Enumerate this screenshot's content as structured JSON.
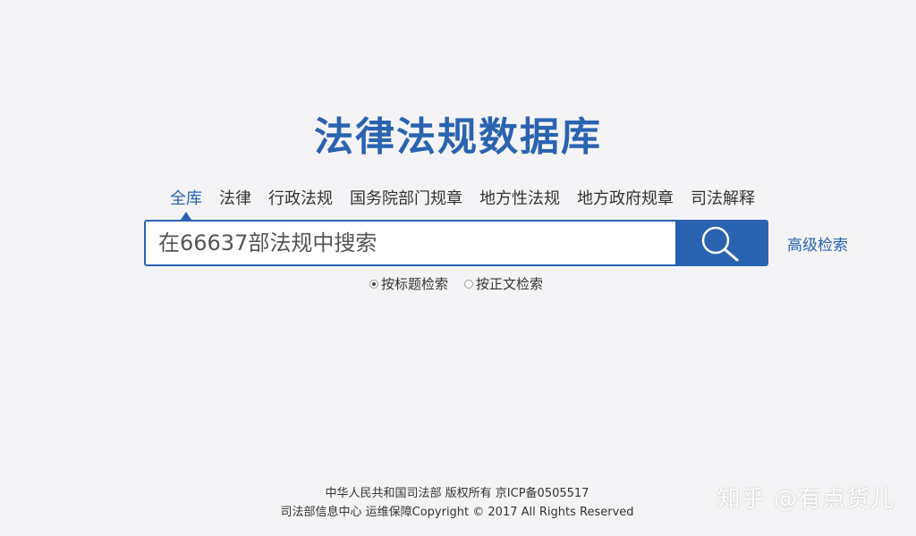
{
  "site_title": "法律法规数据库",
  "tabs": [
    {
      "label": "全库",
      "active": true
    },
    {
      "label": "法律",
      "active": false
    },
    {
      "label": "行政法规",
      "active": false
    },
    {
      "label": "国务院部门规章",
      "active": false
    },
    {
      "label": "地方性法规",
      "active": false
    },
    {
      "label": "地方政府规章",
      "active": false
    },
    {
      "label": "司法解释",
      "active": false
    }
  ],
  "search": {
    "placeholder": "在66637部法规中搜索",
    "button_icon": "search-icon"
  },
  "advanced_search_label": "高级检索",
  "search_options": [
    {
      "label": "按标题检索",
      "checked": true
    },
    {
      "label": "按正文检索",
      "checked": false
    }
  ],
  "footer": {
    "line1": "中华人民共和国司法部 版权所有 京ICP备0505517",
    "line2": "司法部信息中心 运维保障Copyright © 2017 All Rights Reserved"
  },
  "watermark": "知乎 @有点货儿",
  "colors": {
    "accent": "#2a63b0",
    "background": "#f4f4f6"
  }
}
